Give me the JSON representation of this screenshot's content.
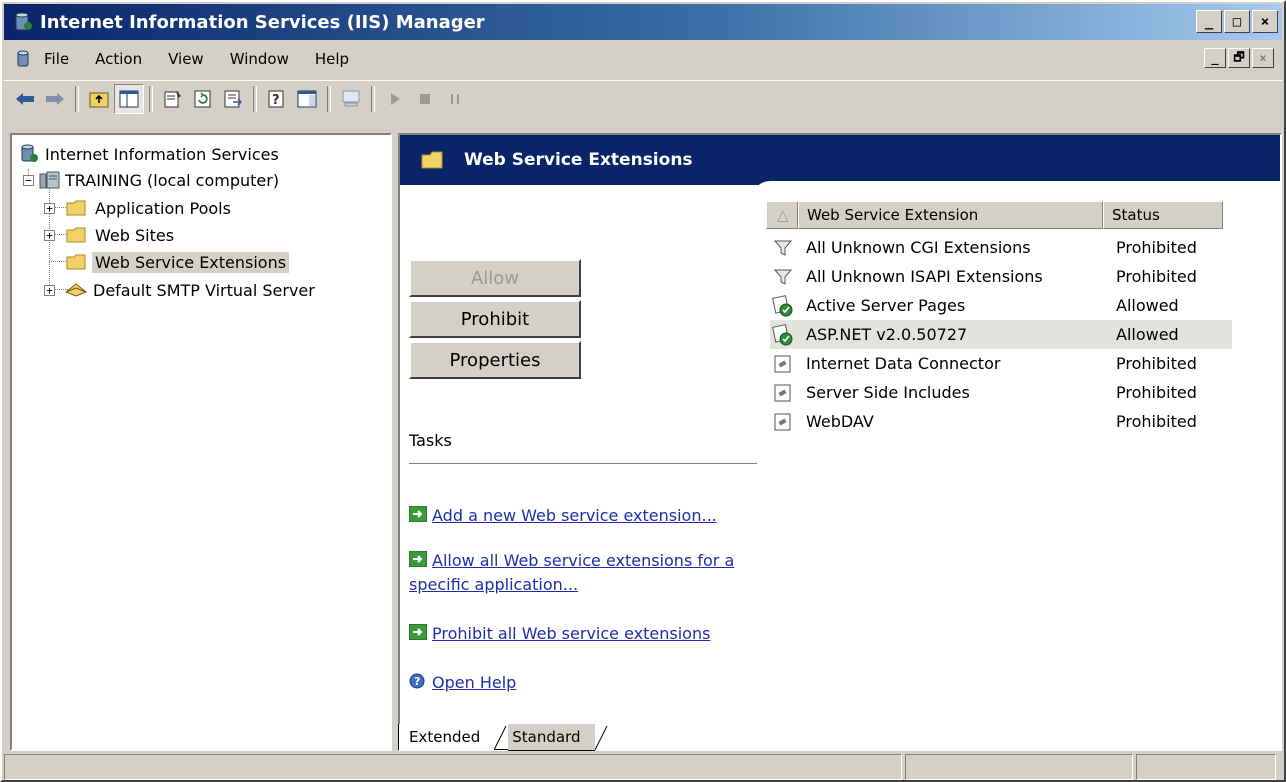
{
  "window": {
    "title": "Internet Information Services (IIS) Manager",
    "minimize_glyph": "_",
    "maximize_glyph": "□",
    "close_glyph": "×",
    "mdi_minimize_glyph": "_",
    "mdi_restore_glyph": "🗗",
    "mdi_close_glyph": "×"
  },
  "menu": {
    "items": [
      {
        "label": "File"
      },
      {
        "label": "Action"
      },
      {
        "label": "View"
      },
      {
        "label": "Window"
      },
      {
        "label": "Help"
      }
    ]
  },
  "toolbar": {
    "buttons": [
      {
        "icon": "back-arrow-icon"
      },
      {
        "icon": "forward-arrow-icon"
      },
      {
        "icon": "up-folder-icon"
      },
      {
        "icon": "show-hide-tree-icon",
        "pressed": true
      },
      {
        "icon": "properties-icon"
      },
      {
        "icon": "refresh-icon"
      },
      {
        "icon": "export-list-icon"
      },
      {
        "icon": "help-icon"
      },
      {
        "icon": "action-pane-icon"
      },
      {
        "icon": "computer-icon"
      },
      {
        "icon": "play-icon"
      },
      {
        "icon": "stop-icon"
      },
      {
        "icon": "pause-icon"
      }
    ]
  },
  "tree": {
    "root": {
      "label": "Internet Information Services"
    },
    "server": {
      "label": "TRAINING (local computer)",
      "expander": "−"
    },
    "children": [
      {
        "label": "Application Pools",
        "expander": "+"
      },
      {
        "label": "Web Sites",
        "expander": "+"
      },
      {
        "label": "Web Service Extensions",
        "selected": true
      },
      {
        "label": "Default SMTP Virtual Server",
        "expander": "+"
      }
    ]
  },
  "details": {
    "banner_title": "Web Service Extensions",
    "buttons": {
      "allow": "Allow",
      "prohibit": "Prohibit",
      "properties": "Properties"
    },
    "tasks_label": "Tasks",
    "tasks": [
      {
        "label": "Add a new Web service extension..."
      },
      {
        "label": "Allow all Web service extensions for a specific application..."
      },
      {
        "label": "Prohibit all Web service extensions"
      },
      {
        "label": "Open Help"
      }
    ],
    "list": {
      "columns": {
        "sort_glyph": "△",
        "name": "Web Service Extension",
        "status": "Status"
      },
      "rows": [
        {
          "name": "All Unknown CGI Extensions",
          "status": "Prohibited",
          "icon": "filter-icon"
        },
        {
          "name": "All Unknown ISAPI Extensions",
          "status": "Prohibited",
          "icon": "filter-icon"
        },
        {
          "name": "Active Server Pages",
          "status": "Allowed",
          "icon": "allowed-extension-icon"
        },
        {
          "name": "ASP.NET v2.0.50727",
          "status": "Allowed",
          "icon": "allowed-extension-icon"
        },
        {
          "name": "Internet Data Connector",
          "status": "Prohibited",
          "icon": "extension-icon"
        },
        {
          "name": "Server Side Includes",
          "status": "Prohibited",
          "icon": "extension-icon"
        },
        {
          "name": "WebDAV",
          "status": "Prohibited",
          "icon": "extension-icon"
        }
      ]
    },
    "tabs": [
      {
        "label": "Extended",
        "active": true
      },
      {
        "label": "Standard",
        "active": false
      }
    ]
  },
  "colors": {
    "banner": "#0a246a",
    "link": "#1d2fa8",
    "titlebar_start": "#0a246a",
    "titlebar_end": "#a6caf0"
  }
}
